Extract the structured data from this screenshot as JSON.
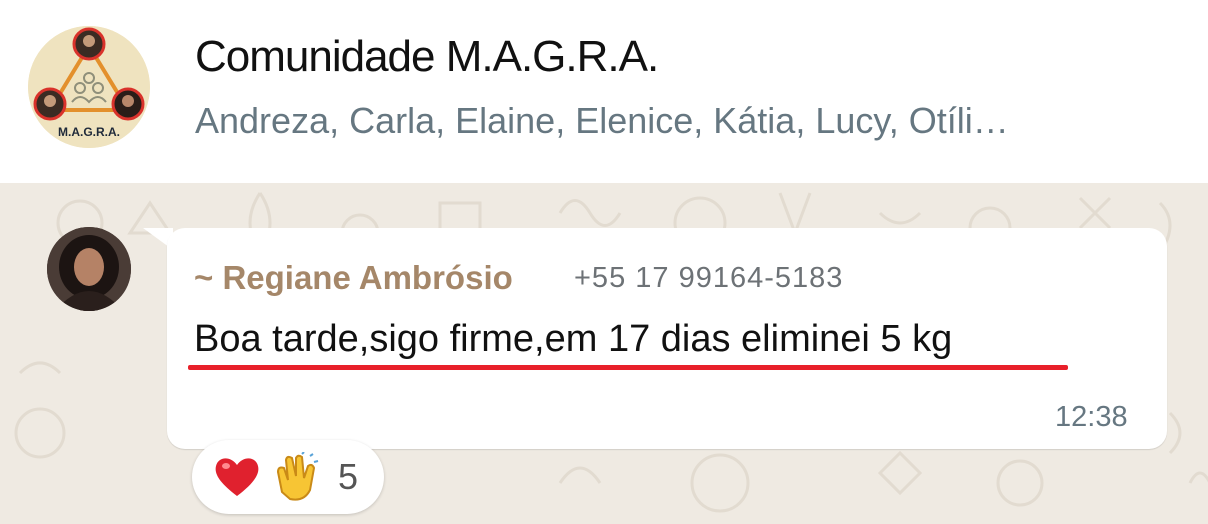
{
  "header": {
    "group_name": "Comunidade M.A.G.R.A.",
    "members": "Andreza, Carla, Elaine, Elenice, Kátia, Lucy, Otíli…",
    "avatar_logo_text": "M.A.G.R.A."
  },
  "message": {
    "sender_name": "~ Regiane Ambrósio",
    "sender_phone": "+55 17 99164-5183",
    "text": "Boa tarde,sigo firme,em 17 dias eliminei 5 kg",
    "time": "12:38"
  },
  "reactions": {
    "emojis": [
      "heart-icon",
      "clapping-hands-icon"
    ],
    "count": "5"
  },
  "colors": {
    "header_bg": "#ffffff",
    "chat_bg": "#efeae2",
    "sender_name": "#a58769",
    "underline": "#e8202a",
    "meta_text": "#667781"
  }
}
